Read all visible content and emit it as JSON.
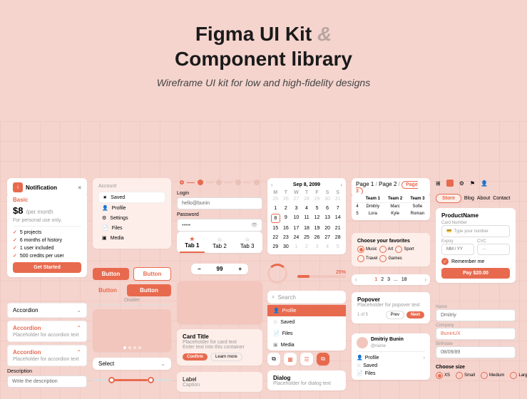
{
  "hero": {
    "title1": "Figma UI Kit",
    "amp": "&",
    "title2": "Component library",
    "subtitle": "Wireframe UI kit for low and high-fidelity designs"
  },
  "notification": {
    "label": "Notification",
    "close": "×"
  },
  "pricing": {
    "tier": "Basic",
    "price": "$8",
    "per": "/per month",
    "note": "For personal use only.",
    "features": [
      "5 projects",
      "6 months of history",
      "1 user included",
      "500 credits per user"
    ],
    "cta": "Get Started"
  },
  "accordion": {
    "items": [
      "Accordion",
      "Accordion",
      "Accordion"
    ],
    "placeholder": "Placeholder for accordion text"
  },
  "description": {
    "label": "Description",
    "placeholder": "Write the description"
  },
  "account": {
    "title": "Account",
    "items": [
      {
        "icon": "★",
        "label": "Saved",
        "active": true
      },
      {
        "icon": "👤",
        "label": "Profile"
      },
      {
        "icon": "⚙",
        "label": "Settings"
      },
      {
        "icon": "📄",
        "label": "Files"
      },
      {
        "icon": "▣",
        "label": "Media"
      }
    ]
  },
  "buttons": {
    "primary": "Button",
    "secondary": "Button",
    "text": "Button"
  },
  "dividerLabel": "Divider",
  "select": {
    "label": "Select"
  },
  "login": {
    "title": "Login",
    "email": "hello@bunin",
    "passwordLabel": "Password",
    "passwordVal": "•••••"
  },
  "tabs": [
    "Tab 1",
    "Tab 2",
    "Tab 3"
  ],
  "stepper": {
    "minus": "−",
    "value": "99",
    "plus": "+"
  },
  "cardTitle": {
    "title": "Card Title",
    "line1": "Placeholder for card text",
    "line2": "Enter text into this container",
    "confirm": "Confirm",
    "learn": "Learn more"
  },
  "label": {
    "title": "Label",
    "caption": "Caption"
  },
  "calendar": {
    "month": "Sep 8, 2099",
    "dow": [
      "M",
      "T",
      "W",
      "T",
      "F",
      "S",
      "S"
    ],
    "days": [
      {
        "n": "25",
        "dim": true
      },
      {
        "n": "26",
        "dim": true
      },
      {
        "n": "27",
        "dim": true
      },
      {
        "n": "28",
        "dim": true
      },
      {
        "n": "29",
        "dim": true
      },
      {
        "n": "30",
        "dim": true
      },
      {
        "n": "31",
        "dim": true
      },
      {
        "n": "1"
      },
      {
        "n": "2"
      },
      {
        "n": "3"
      },
      {
        "n": "4"
      },
      {
        "n": "5"
      },
      {
        "n": "6"
      },
      {
        "n": "7"
      },
      {
        "n": "8",
        "sel": true
      },
      {
        "n": "9"
      },
      {
        "n": "10"
      },
      {
        "n": "11"
      },
      {
        "n": "12"
      },
      {
        "n": "13"
      },
      {
        "n": "14"
      },
      {
        "n": "15"
      },
      {
        "n": "16"
      },
      {
        "n": "17"
      },
      {
        "n": "18"
      },
      {
        "n": "19"
      },
      {
        "n": "20"
      },
      {
        "n": "21"
      },
      {
        "n": "22"
      },
      {
        "n": "23"
      },
      {
        "n": "24"
      },
      {
        "n": "25"
      },
      {
        "n": "26"
      },
      {
        "n": "27"
      },
      {
        "n": "28"
      },
      {
        "n": "29"
      },
      {
        "n": "30"
      },
      {
        "n": "1",
        "dim": true
      },
      {
        "n": "2",
        "dim": true
      },
      {
        "n": "3",
        "dim": true
      },
      {
        "n": "4",
        "dim": true
      },
      {
        "n": "5",
        "dim": true
      }
    ]
  },
  "progress": {
    "pct": "25%"
  },
  "search": {
    "placeholder": "Search"
  },
  "searchMenu": {
    "profile": "Profile",
    "items": [
      "Saved",
      "Files",
      "Media"
    ]
  },
  "dialog": {
    "title": "Dialog",
    "text": "Placeholder for dialog text"
  },
  "breadcrumb": {
    "p1": "Page 1",
    "p2": "Page 2",
    "p3": "Page 3",
    "sep": "/"
  },
  "table": {
    "headers": [
      "",
      "Team 1",
      "Team 2",
      "Team 3"
    ],
    "rows": [
      [
        "4",
        "Dmitriy",
        "Marc",
        "Sofie"
      ],
      [
        "5",
        "Lora",
        "Kyle",
        "Roman"
      ]
    ]
  },
  "favorites": {
    "title": "Choose your favorites",
    "chips": [
      "Music",
      "Art",
      "Sport",
      "Travel",
      "Games"
    ],
    "selected": [
      0
    ]
  },
  "pagination": {
    "items": [
      "1",
      "2",
      "3",
      "...",
      "18"
    ]
  },
  "popover": {
    "title": "Popover",
    "text": "Placeholder for popover text",
    "prev": "Prev",
    "next": "Next",
    "count": "1 of 5"
  },
  "userCard": {
    "name": "Dmitriy Bunin",
    "handle": "@name",
    "menu": [
      "Profile",
      "Saved",
      "Files"
    ]
  },
  "nav": {
    "items": [
      "Store",
      "Blog",
      "About",
      "Contact"
    ],
    "active": 0
  },
  "checkout": {
    "title": "ProductName",
    "cardLabel": "Card Number",
    "cardPlaceholder": "Type your number",
    "expiryLabel": "Expiry",
    "expiryPlaceholder": "MM / YY",
    "cvcLabel": "CVC",
    "cvcPlaceholder": "···",
    "remember": "Remember me",
    "pay": "Pay $20.00"
  },
  "form": {
    "nameLabel": "Name",
    "nameVal": "Dmitriy",
    "companyLabel": "Company",
    "companyVal": "BuninUX",
    "birthLabel": "Birthdate",
    "birthVal": "08/09/89"
  },
  "sizes": {
    "title": "Choose size",
    "opts": [
      "XS",
      "Small",
      "Medium",
      "Large"
    ],
    "selected": 0
  }
}
